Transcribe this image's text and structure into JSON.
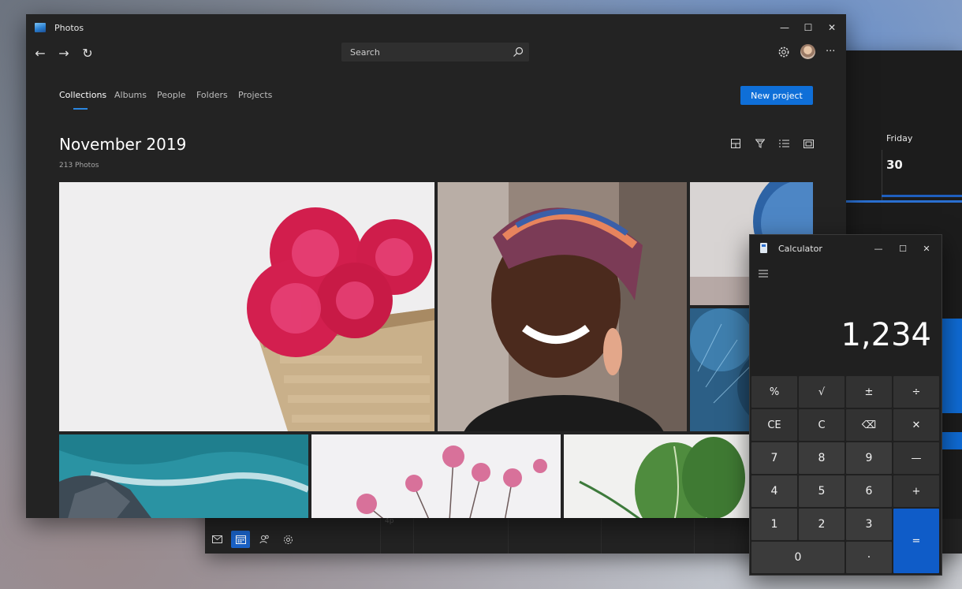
{
  "photos_window": {
    "title": "Photos",
    "window_controls": {
      "minimize": "—",
      "maximize": "☐",
      "close": "✕"
    },
    "nav": {
      "back": "←",
      "forward": "→",
      "refresh": "↻"
    },
    "search": {
      "placeholder": "Search"
    },
    "tabs": [
      {
        "label": "Collections",
        "active": true
      },
      {
        "label": "Albums"
      },
      {
        "label": "People"
      },
      {
        "label": "Folders"
      },
      {
        "label": "Projects"
      }
    ],
    "new_project_label": "New project",
    "collection_title": "November 2019",
    "photo_count": "213 Photos",
    "more_glyph": "···"
  },
  "calendar_window": {
    "day_name": "Friday",
    "date": "30",
    "small_text": "4p"
  },
  "calculator": {
    "title": "Calculator",
    "window_controls": {
      "minimize": "—",
      "maximize": "☐",
      "close": "✕"
    },
    "display": "1,234",
    "keys": [
      [
        "%",
        "√",
        "±",
        "÷"
      ],
      [
        "CE",
        "C",
        "⌫",
        "✕"
      ],
      [
        "7",
        "8",
        "9",
        "—"
      ],
      [
        "4",
        "5",
        "6",
        "+"
      ],
      [
        "1",
        "2",
        "3"
      ],
      [
        "0",
        "·",
        "="
      ]
    ]
  },
  "colors": {
    "accent": "#0f6fd8",
    "window_bg": "#232323",
    "calc_bg": "#202020"
  }
}
